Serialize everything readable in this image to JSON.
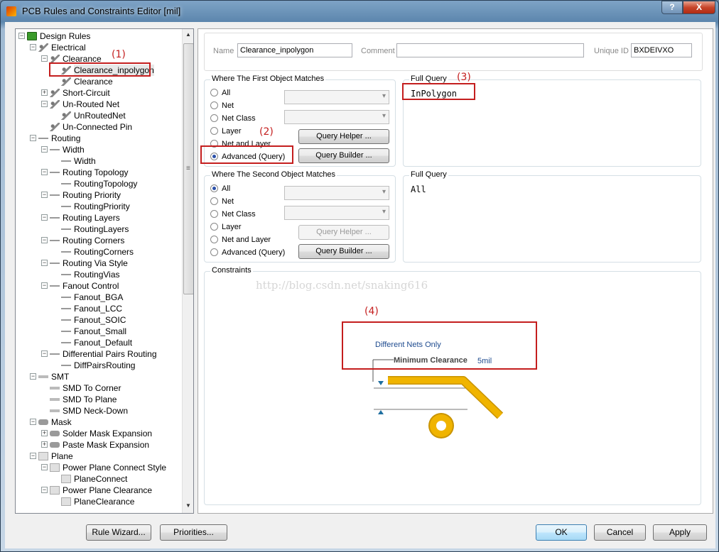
{
  "window": {
    "title": "PCB Rules and Constraints Editor [mil]",
    "help_label": "?",
    "close_label": "X"
  },
  "tree": {
    "items": [
      {
        "label": "Design Rules",
        "level": 0,
        "icon": "design-rules-icon",
        "exp": "−"
      },
      {
        "label": "Electrical",
        "level": 1,
        "icon": "rule-icon",
        "exp": "−"
      },
      {
        "label": "Clearance",
        "level": 2,
        "icon": "rule-icon",
        "exp": "−"
      },
      {
        "label": "Clearance_inpolygon",
        "level": 3,
        "icon": "rule-icon",
        "exp": "",
        "selected": true
      },
      {
        "label": "Clearance",
        "level": 3,
        "icon": "rule-icon",
        "exp": ""
      },
      {
        "label": "Short-Circuit",
        "level": 2,
        "icon": "rule-icon",
        "exp": "+"
      },
      {
        "label": "Un-Routed Net",
        "level": 2,
        "icon": "rule-icon",
        "exp": "−"
      },
      {
        "label": "UnRoutedNet",
        "level": 3,
        "icon": "rule-icon",
        "exp": ""
      },
      {
        "label": "Un-Connected Pin",
        "level": 2,
        "icon": "rule-icon",
        "exp": ""
      },
      {
        "label": "Routing",
        "level": 1,
        "icon": "routing-icon",
        "exp": "−"
      },
      {
        "label": "Width",
        "level": 2,
        "icon": "routing-icon",
        "exp": "−"
      },
      {
        "label": "Width",
        "level": 3,
        "icon": "routing-icon",
        "exp": ""
      },
      {
        "label": "Routing Topology",
        "level": 2,
        "icon": "routing-icon",
        "exp": "−"
      },
      {
        "label": "RoutingTopology",
        "level": 3,
        "icon": "routing-icon",
        "exp": ""
      },
      {
        "label": "Routing Priority",
        "level": 2,
        "icon": "routing-icon",
        "exp": "−"
      },
      {
        "label": "RoutingPriority",
        "level": 3,
        "icon": "routing-icon",
        "exp": ""
      },
      {
        "label": "Routing Layers",
        "level": 2,
        "icon": "routing-icon",
        "exp": "−"
      },
      {
        "label": "RoutingLayers",
        "level": 3,
        "icon": "routing-icon",
        "exp": ""
      },
      {
        "label": "Routing Corners",
        "level": 2,
        "icon": "routing-icon",
        "exp": "−"
      },
      {
        "label": "RoutingCorners",
        "level": 3,
        "icon": "routing-icon",
        "exp": ""
      },
      {
        "label": "Routing Via Style",
        "level": 2,
        "icon": "routing-icon",
        "exp": "−"
      },
      {
        "label": "RoutingVias",
        "level": 3,
        "icon": "routing-icon",
        "exp": ""
      },
      {
        "label": "Fanout Control",
        "level": 2,
        "icon": "routing-icon",
        "exp": "−"
      },
      {
        "label": "Fanout_BGA",
        "level": 3,
        "icon": "routing-icon",
        "exp": ""
      },
      {
        "label": "Fanout_LCC",
        "level": 3,
        "icon": "routing-icon",
        "exp": ""
      },
      {
        "label": "Fanout_SOIC",
        "level": 3,
        "icon": "routing-icon",
        "exp": ""
      },
      {
        "label": "Fanout_Small",
        "level": 3,
        "icon": "routing-icon",
        "exp": ""
      },
      {
        "label": "Fanout_Default",
        "level": 3,
        "icon": "routing-icon",
        "exp": ""
      },
      {
        "label": "Differential Pairs Routing",
        "level": 2,
        "icon": "routing-icon",
        "exp": "−"
      },
      {
        "label": "DiffPairsRouting",
        "level": 3,
        "icon": "routing-icon",
        "exp": ""
      },
      {
        "label": "SMT",
        "level": 1,
        "icon": "smt-icon",
        "exp": "−"
      },
      {
        "label": "SMD To Corner",
        "level": 2,
        "icon": "smt-icon",
        "exp": ""
      },
      {
        "label": "SMD To Plane",
        "level": 2,
        "icon": "smt-icon",
        "exp": ""
      },
      {
        "label": "SMD Neck-Down",
        "level": 2,
        "icon": "smt-icon",
        "exp": ""
      },
      {
        "label": "Mask",
        "level": 1,
        "icon": "mask-icon",
        "exp": "−"
      },
      {
        "label": "Solder Mask Expansion",
        "level": 2,
        "icon": "mask-icon",
        "exp": "+"
      },
      {
        "label": "Paste Mask Expansion",
        "level": 2,
        "icon": "mask-icon",
        "exp": "+"
      },
      {
        "label": "Plane",
        "level": 1,
        "icon": "plane-icon",
        "exp": "−"
      },
      {
        "label": "Power Plane Connect Style",
        "level": 2,
        "icon": "plane-icon",
        "exp": "−"
      },
      {
        "label": "PlaneConnect",
        "level": 3,
        "icon": "plane-icon",
        "exp": ""
      },
      {
        "label": "Power Plane Clearance",
        "level": 2,
        "icon": "plane-icon",
        "exp": "−"
      },
      {
        "label": "PlaneClearance",
        "level": 3,
        "icon": "plane-icon",
        "exp": ""
      }
    ]
  },
  "header": {
    "name_label": "Name",
    "name_value": "Clearance_inpolygon",
    "comment_label": "Comment",
    "comment_value": "",
    "uid_label": "Unique ID",
    "uid_value": "BXDEIVXO"
  },
  "first": {
    "title": "Where The First Object Matches",
    "options": [
      "All",
      "Net",
      "Net Class",
      "Layer",
      "Net and Layer",
      "Advanced (Query)"
    ],
    "selected": 5,
    "query_helper": "Query Helper ...",
    "query_builder": "Query Builder ...",
    "full_query_title": "Full Query",
    "full_query": "InPolygon"
  },
  "second": {
    "title": "Where The Second Object Matches",
    "options": [
      "All",
      "Net",
      "Net Class",
      "Layer",
      "Net and Layer",
      "Advanced (Query)"
    ],
    "selected": 0,
    "query_helper": "Query Helper ...",
    "query_builder": "Query Builder ...",
    "full_query_title": "Full Query",
    "full_query": "All"
  },
  "constraints": {
    "title": "Constraints",
    "watermark": "http://blog.csdn.net/snaking616",
    "different_nets": "Different Nets Only",
    "min_clearance_label": "Minimum Clearance",
    "min_clearance_value": "5mil"
  },
  "annotations": {
    "a1": "(1)",
    "a2": "(2)",
    "a3": "(3)",
    "a4": "(4)"
  },
  "buttons": {
    "rule_wizard": "Rule Wizard...",
    "priorities": "Priorities...",
    "ok": "OK",
    "cancel": "Cancel",
    "apply": "Apply"
  },
  "colors": {
    "annotation": "#c41e1e",
    "trace": "#f0b400",
    "accent": "#1e4b8f"
  }
}
